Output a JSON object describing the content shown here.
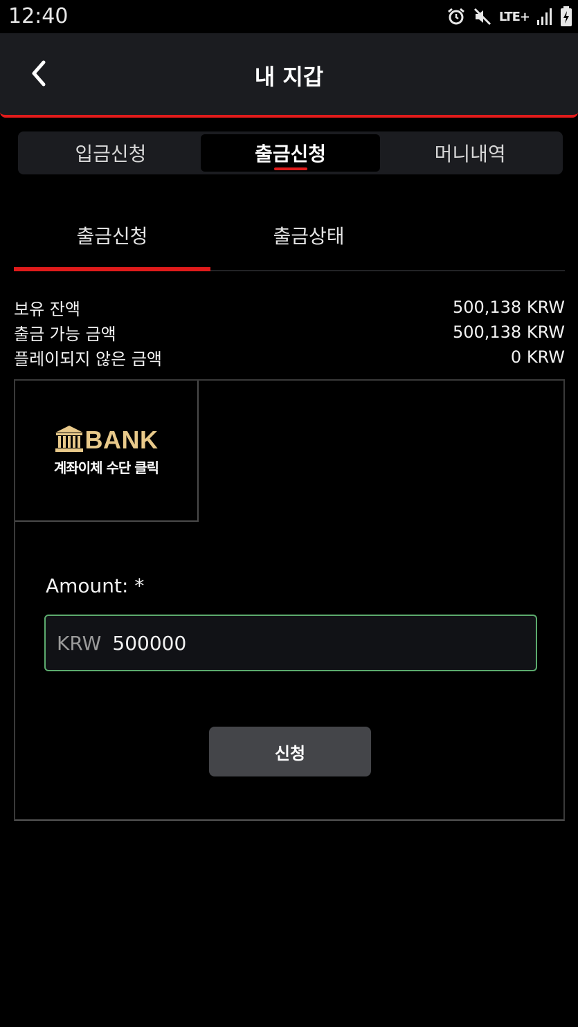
{
  "status_bar": {
    "time": "12:40",
    "network_label": "LTE+",
    "icons": [
      "alarm-icon",
      "mute-icon",
      "lte-icon",
      "signal-icon",
      "battery-charging-icon"
    ]
  },
  "header": {
    "title": "내 지갑",
    "back_icon": "chevron-left-icon"
  },
  "top_tabs": [
    {
      "label": "입금신청",
      "active": false
    },
    {
      "label": "출금신청",
      "active": true
    },
    {
      "label": "머니내역",
      "active": false
    }
  ],
  "sub_tabs": [
    {
      "label": "출금신청",
      "active": true
    },
    {
      "label": "출금상태",
      "active": false
    }
  ],
  "balances": [
    {
      "label": "보유 잔액",
      "value": "500,138 KRW"
    },
    {
      "label": "출금 가능 금액",
      "value": "500,138 KRW"
    },
    {
      "label": "플레이되지 않은 금액",
      "value": "0 KRW"
    }
  ],
  "payment_method": {
    "logo_text": "BANK",
    "subtitle": "계좌이체 수단 클릭",
    "icon": "bank-building-icon"
  },
  "amount": {
    "label": "Amount: *",
    "currency": "KRW",
    "value": "500000"
  },
  "submit_label": "신청",
  "colors": {
    "accent": "#e01b1b",
    "header_bg": "#1b1c20",
    "field_border": "#5cab6e",
    "bank_gold": "#e8c98a",
    "button_bg": "#444549"
  }
}
